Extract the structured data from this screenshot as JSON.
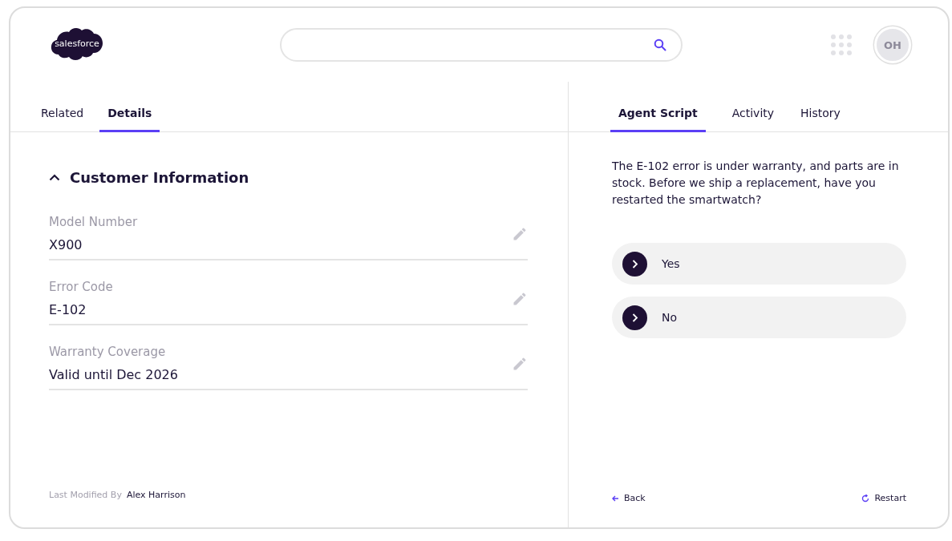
{
  "header": {
    "logo": "salesforce",
    "avatar": "OH"
  },
  "left_tabs": [
    {
      "label": "Related",
      "selected": false
    },
    {
      "label": "Details",
      "selected": true
    }
  ],
  "section": {
    "title": "Customer Information",
    "expanded": true
  },
  "fields": [
    {
      "label": "Model Number",
      "value": "X900"
    },
    {
      "label": "Error Code",
      "value": "E-102"
    },
    {
      "label": "Warranty Coverage",
      "value": "Valid until Dec 2026"
    }
  ],
  "footer": {
    "label": "Last Modified By",
    "value": "Alex Harrison"
  },
  "right_tabs": [
    {
      "label": "Agent Script",
      "selected": true
    },
    {
      "label": "Activity",
      "selected": false
    },
    {
      "label": "History",
      "selected": false
    }
  ],
  "script_text": "The E-102 error is under warranty, and parts are in stock. Before we ship a replacement, have you restarted the smartwatch?",
  "answers": [
    "Yes",
    "No"
  ],
  "nav": {
    "back": "Back",
    "restart": "Restart"
  }
}
